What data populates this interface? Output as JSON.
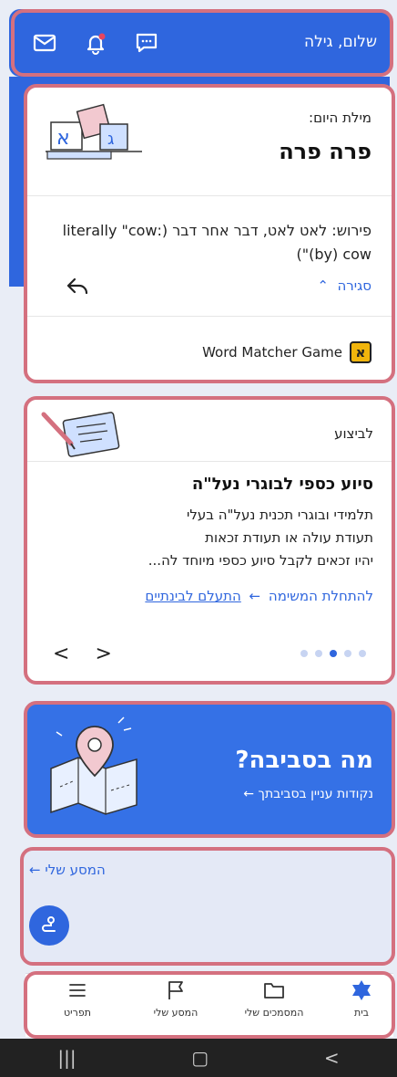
{
  "header": {
    "greeting": "שלום, גילה"
  },
  "word_of_day": {
    "label": "מילת היום:",
    "word": "פרה פרה",
    "definition": "פירוש: לאט לאט, דבר אחר דבר (:literally \"cow (by) cow\")",
    "close_label": "סגירה",
    "game_badge": "א",
    "game_label": "Word Matcher Game"
  },
  "execution": {
    "label": "לביצוע",
    "title": "סיוע כספי לבוגרי נעל\"ה",
    "body_lines": [
      "תלמידי ובוגרי תכנית נעל\"ה בעלי",
      "תעודת עולה או תעודת זכאות",
      "יהיו זכאים לקבל סיוע כספי מיוחד לה..."
    ],
    "start_link": "להתחלת המשימה",
    "ignore_link": "התעלם לבינתיים",
    "dots_count": 5,
    "active_dot": 2
  },
  "nearby": {
    "title": "?מה בסביבה",
    "subtitle": "נקודות עניין בסביבתך"
  },
  "trip": {
    "link": "המסע שלי"
  },
  "bottom_nav": [
    {
      "label": "בית"
    },
    {
      "label": "המסמכים שלי"
    },
    {
      "label": "המסע שלי"
    },
    {
      "label": "תפריט"
    }
  ],
  "colors": {
    "primary": "#2f66de",
    "highlight": "#d4707f"
  }
}
